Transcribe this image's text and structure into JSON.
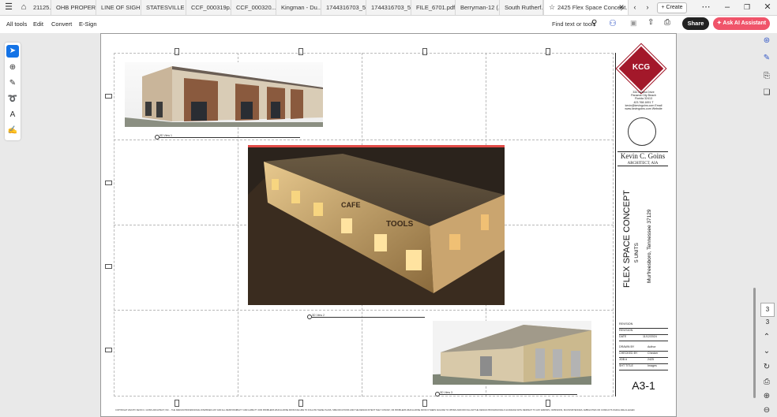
{
  "tabs": [
    {
      "label": "21125..."
    },
    {
      "label": "OHB PROPER..."
    },
    {
      "label": "LINE OF SIGH..."
    },
    {
      "label": "STATESVILLE ..."
    },
    {
      "label": "CCF_000319p..."
    },
    {
      "label": "CCF_000320..."
    },
    {
      "label": "Kingman - Du..."
    },
    {
      "label": "1744316703_5..."
    },
    {
      "label": "1744316703_5..."
    },
    {
      "label": "FILE_6701.pdf"
    },
    {
      "label": "Berryman-12 (..."
    },
    {
      "label": "South Rutherf..."
    },
    {
      "label": "2425 Flex Space Concept..."
    }
  ],
  "create_label": "Create",
  "menu": {
    "all_tools": "All tools",
    "edit": "Edit",
    "convert": "Convert",
    "esign": "E-Sign"
  },
  "find_placeholder": "Find text or tools",
  "share_label": "Share",
  "ai_label": "Ask AI Assistant",
  "page_numbers": {
    "current": "3",
    "total": "3"
  },
  "drawing": {
    "firm_logo": "KCG",
    "firm_address": [
      "332 Azalea Drive",
      "Panama City Beach",
      "Florida 32413",
      "423.768.1691 T",
      "kevin@kevingoins.com Email",
      "www.kevingoins.com Website"
    ],
    "architect_name": "Kevin C. Goins",
    "architect_title": "ARCHITECT, AIA",
    "project_title": "FLEX SPACE CONCEPT",
    "project_units": "5 UNITS",
    "project_location": "Murfreesboro, Tennessee 37129",
    "revision_labels": [
      "REVISION",
      "REVISION",
      "DATE"
    ],
    "date_value": "11/12/2024",
    "drawn_by_label": "DRAWN BY",
    "drawn_by": "Author",
    "checked_by_label": "CHECKED BY",
    "checked_by": "Checker",
    "job_label": "JOB #",
    "job": "2425",
    "sheet_title_label": "SHT TITLE",
    "sheet_title": "Images",
    "sheet_number": "A3-1",
    "view_labels": [
      "3D View 1",
      "3D View 2",
      "3D View 3"
    ],
    "signs": {
      "cafe": "CAFE",
      "tools": "TOOLS"
    },
    "copyright": "COPYRIGHT 2024 BY KEVIN C. GOINS ARCHITECT, INC. - THE DESIGN PROFESSIONAL DISMISSES ANY AND ALL RESPONSIBILITY AND LIABILITY FOR PROBLEMS WHICH ARISE FROM FAILURE TO FOLLOW THESE PLANS, SPECIFICATIONS AND THE DESIGN INTENT THEY CONVEY, OR PROBLEMS WHICH ARISE FROM OTHERS FAILURE TO OBTAIN AND/OR FOLLOW THE DESIGN PROFESSIONALS GUIDANCE WITH RESPECT TO ANY ERRORS, OMISSIONS, INCONSISTENCIES, AMBIGUITIES OR CONFLICTS WHICH ARE ALLEGED."
  },
  "colors": {
    "accent": "#1473e6",
    "ai": "#f0546a",
    "logo": "#a3182a"
  }
}
